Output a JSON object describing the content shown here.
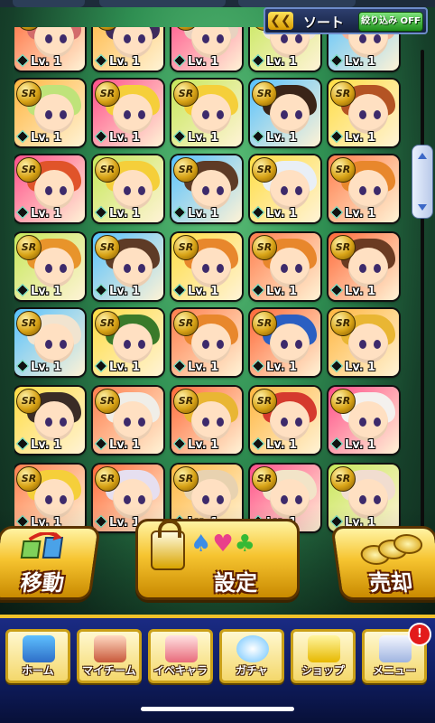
{
  "header": {
    "sort_label": "ソート",
    "filter_label": "絞り込み OFF",
    "sort_arrow": "❮❮"
  },
  "cards": {
    "rarity": "SR",
    "level": "Lv. 1",
    "rows": [
      [
        "#d36b6b",
        "#3e2a5c",
        "#e8d2c0",
        "#f0e7dc",
        "#f2b49a"
      ],
      [
        "#bfe37a",
        "#f5cf3a",
        "#f5cf3a",
        "#3a2418",
        "#b45424"
      ],
      [
        "#e0542a",
        "#f5cf3a",
        "#5e3b26",
        "#e9eff6",
        "#e8872c"
      ],
      [
        "#e8942b",
        "#5e3b26",
        "#e8872c",
        "#e8872c",
        "#6b3b22"
      ],
      [
        "#f1e4d0",
        "#3a7a2a",
        "#e8872c",
        "#2b5fc2",
        "#e9b633"
      ],
      [
        "#3a2c26",
        "#f0eee8",
        "#e9b633",
        "#d53a2e",
        "#f4f1ee"
      ],
      [
        "#f5cf3a",
        "#e6dff0",
        "#e8d2b0",
        "#f2e4c8",
        "#f1ddd0"
      ]
    ]
  },
  "actions": {
    "move_label": "移動",
    "settings_label": "設定",
    "sell_label": "売却"
  },
  "nav": {
    "items": [
      {
        "label": "ホーム"
      },
      {
        "label": "マイチーム"
      },
      {
        "label": "イベキャラ"
      },
      {
        "label": "ガチャ"
      },
      {
        "label": "ショップ"
      },
      {
        "label": "メニュー"
      }
    ],
    "menu_badge": "!"
  }
}
